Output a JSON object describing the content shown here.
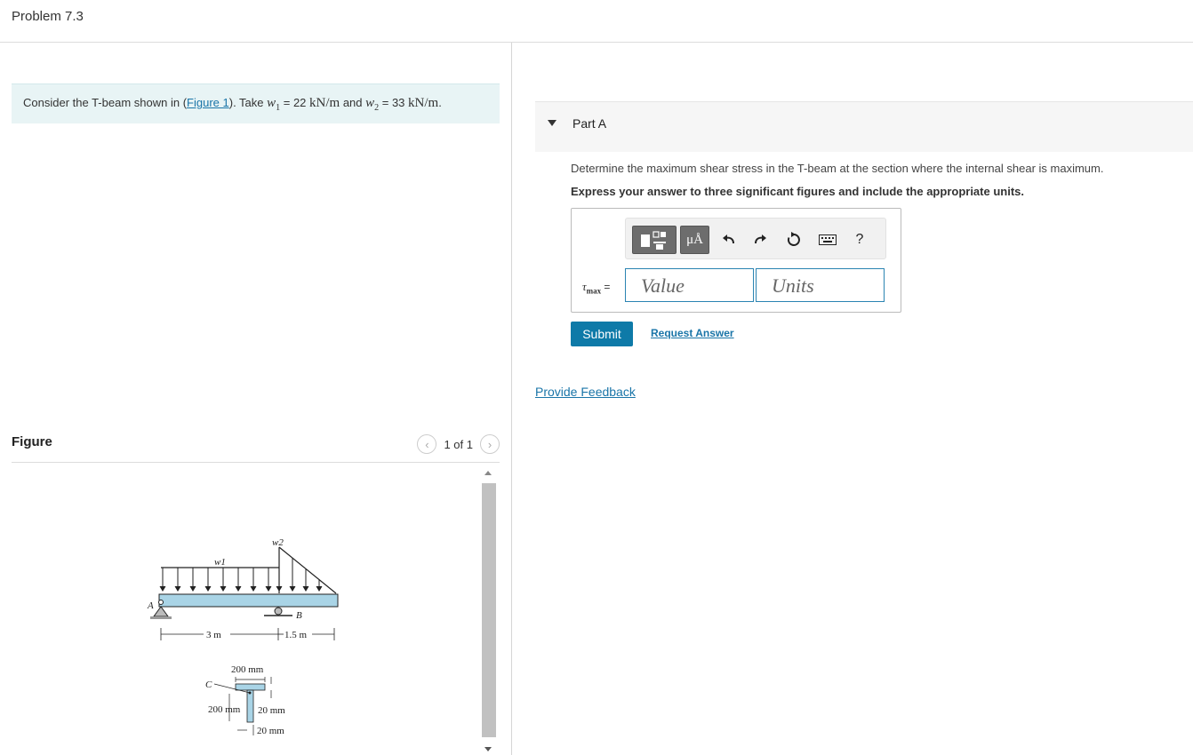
{
  "header": {
    "title": "Problem 7.3"
  },
  "intro": {
    "text_before": "Consider the T-beam shown in (",
    "link": "Figure 1",
    "text_take": "). Take ",
    "w1_var": "w",
    "w1_sub": "1",
    "w1_value": " = 22 ",
    "unit1": "kN/m",
    "and_text": " and ",
    "w2_var": "w",
    "w2_sub": "2",
    "w2_value": " = 33 ",
    "unit2": "kN/m",
    "end": "."
  },
  "figure": {
    "title": "Figure",
    "pager": "1 of 1",
    "labels": {
      "w1": "w1",
      "w2": "w2",
      "A": "A",
      "B": "B",
      "C": "C",
      "span1": "3 m",
      "span2": "1.5 m",
      "flange_width": "200 mm",
      "web_height": "200 mm",
      "flange_thick": "20 mm",
      "web_thick": "20 mm"
    }
  },
  "part": {
    "title": "Part A",
    "question": "Determine the maximum shear stress in the T-beam at the section where the internal shear is maximum.",
    "instruction": "Express your answer to three significant figures and include the appropriate units.",
    "tau_symbol": "τ",
    "tau_sub": "max",
    "equals": "=",
    "value_placeholder": "Value",
    "units_placeholder": "Units",
    "toolbar": {
      "units_btn": "μÅ",
      "help": "?"
    },
    "submit": "Submit",
    "request": "Request Answer"
  },
  "feedback": "Provide Feedback"
}
